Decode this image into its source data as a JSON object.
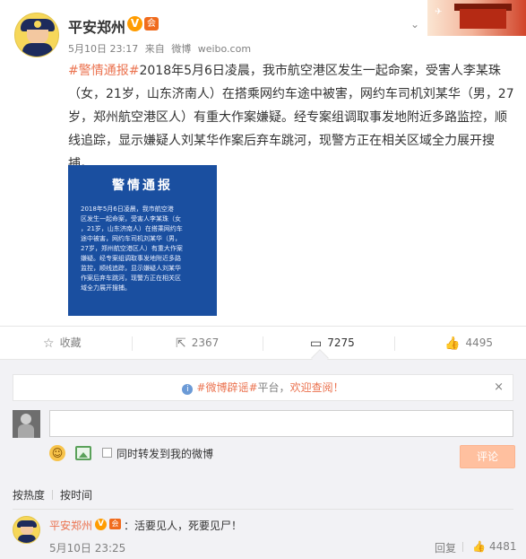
{
  "post": {
    "author_name": "平安郑州",
    "verified_mark": "V",
    "vip_mark": "会",
    "date": "5月10日 23:17",
    "source_prefix": "来自",
    "source_client": "微博",
    "source_domain": "weibo.com",
    "hashtag": "#警情通报#",
    "text_lines": [
      "2018年5月6日凌晨，我市航空港区发生一起命案，受害人李某珠",
      "（女，21岁，山东济南人）在搭乘网约车途中被害，网约车司机刘某华（男，27",
      "岁，郑州航空港区人）有重大作案嫌疑。经专案组调取事发地附近多路监控，顺",
      "线追踪，显示嫌疑人刘某华作案后弃车跳河，现警方正在相关区域全力展开搜",
      "捕。"
    ]
  },
  "notice_image": {
    "title": "警情通报",
    "lines": [
      "2018年5月6日凌晨，我市航空港",
      "区发生一起命案，受害人李某珠（女",
      "，21岁，山东济南人）在搭乘网约车",
      "途中被害，网约车司机刘某华（男，",
      "27岁，郑州航空港区人）有重大作案",
      "嫌疑。经专案组调取事发地附近多路",
      "监控，顺线追踪，显示嫌疑人刘某华",
      "作案后弃车跳河，现警方正在相关区",
      "域全力展开搜捕。"
    ]
  },
  "actions": {
    "favorite_label": "收藏",
    "repost_count": "2367",
    "comment_count": "7275",
    "like_count": "4495"
  },
  "comment_box": {
    "rumor_tag": "#微博辟谣#",
    "rumor_text": "平台，",
    "rumor_link": "欢迎查阅！",
    "rumor_close": "×",
    "repost_label": "同时转发到我的微博",
    "submit_label": "评论"
  },
  "sort": {
    "hot": "按热度",
    "time": "按时间"
  },
  "comments": [
    {
      "author": "平安郑州",
      "verified_mark": "V",
      "vip_mark": "会",
      "text": "：活要见人，死要见尸！",
      "time": "5月10日 23:25",
      "reply_label": "回复",
      "like_count": "4481"
    }
  ],
  "colors": {
    "accent": "#eb7350",
    "notice_bg": "#1a4fa0",
    "submit_bg": "#ffc09f"
  },
  "icons": {
    "favorite": "star-icon",
    "repost": "repost-icon",
    "comment": "comment-icon",
    "like": "thumbs-up-icon",
    "expand": "chevron-down-icon"
  }
}
